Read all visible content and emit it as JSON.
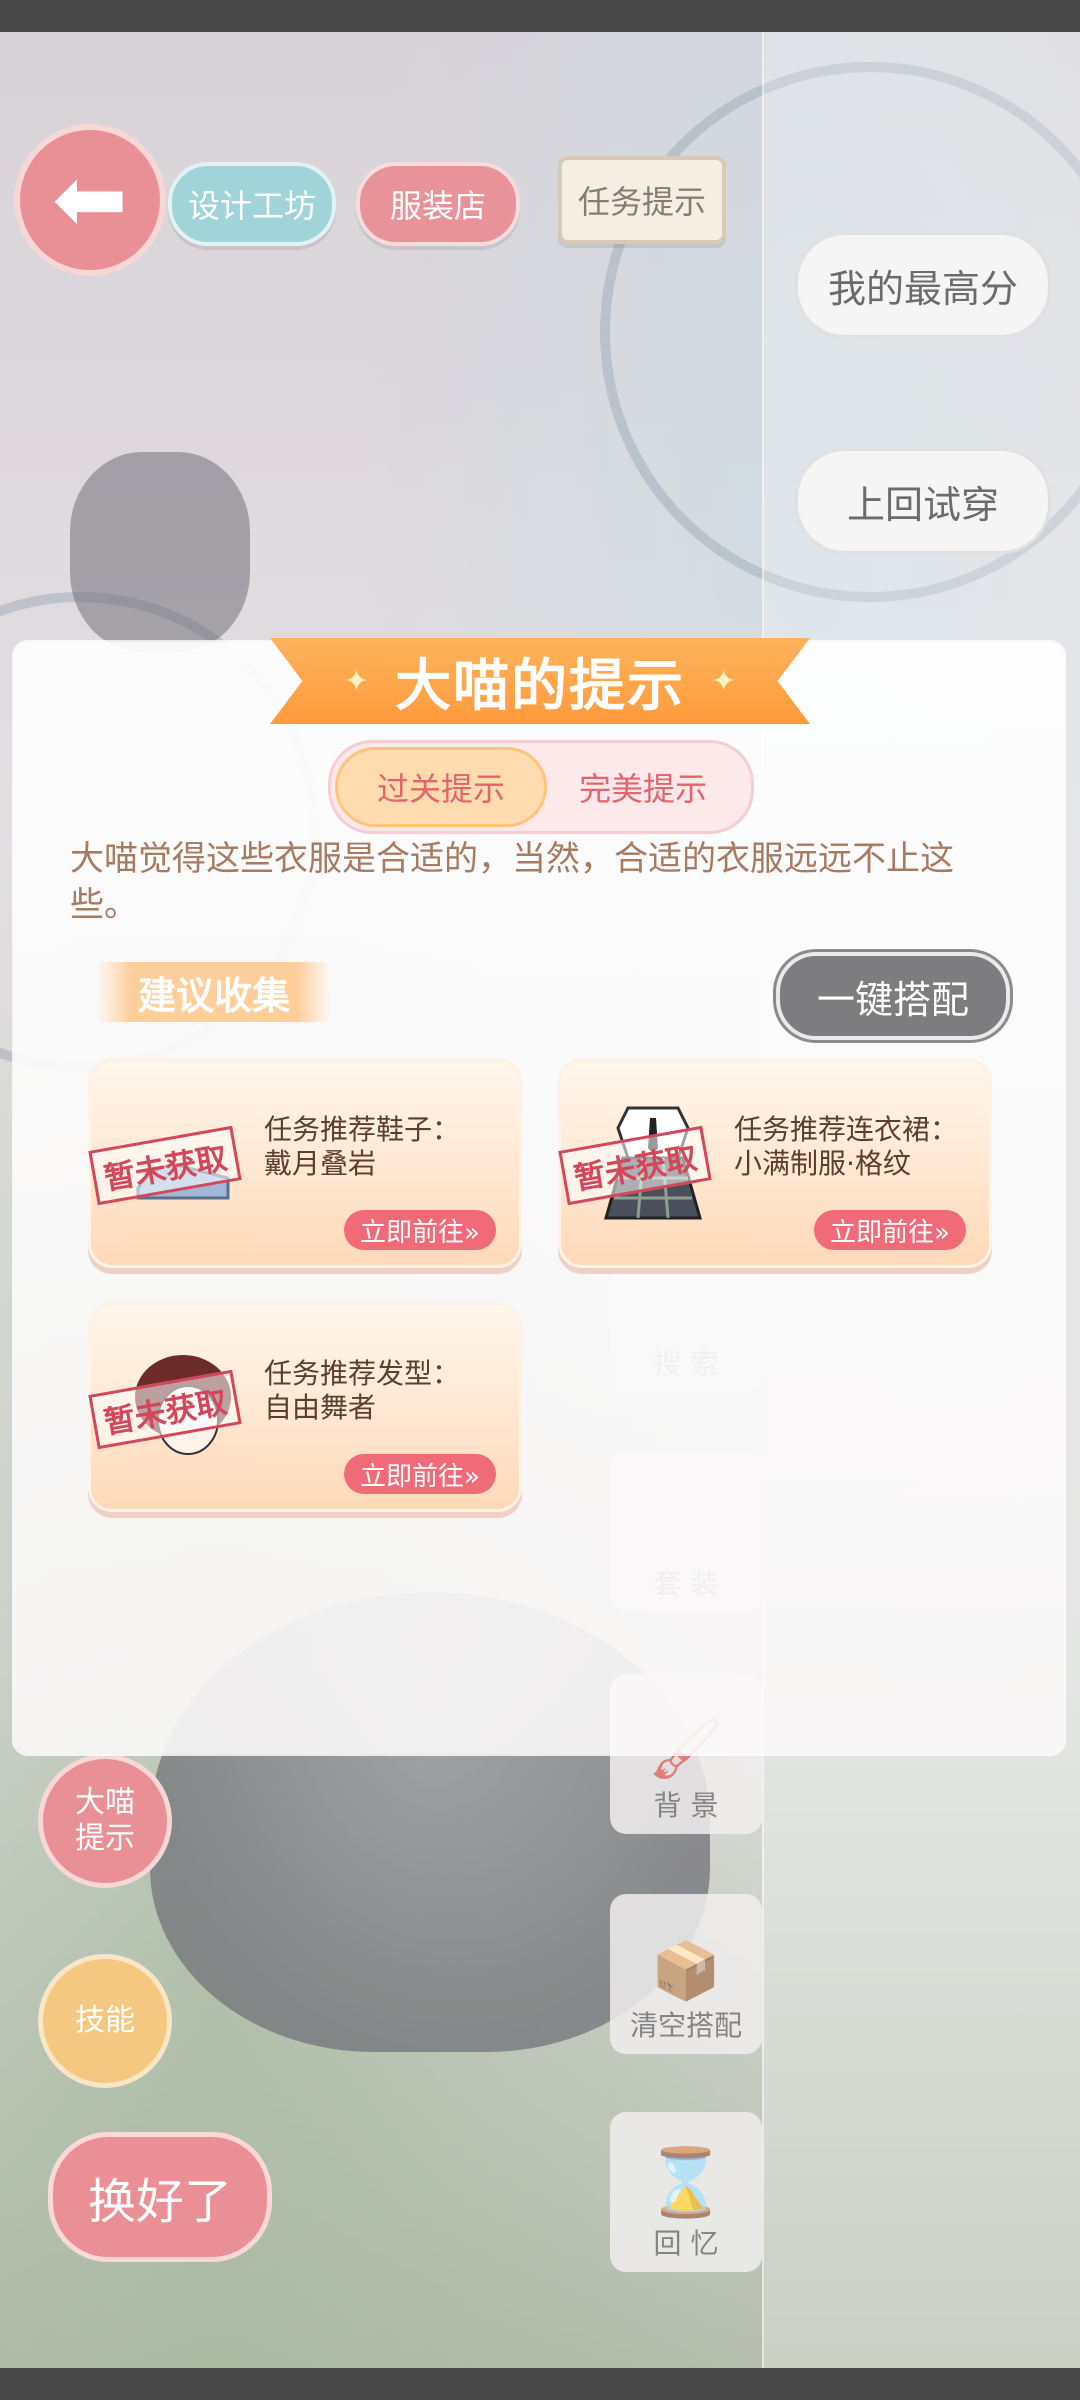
{
  "top_bar": {
    "back_icon": "arrow-left-icon",
    "design_workshop": "设计工坊",
    "clothing_store": "服装店",
    "task_hint": "任务提示"
  },
  "side_buttons": {
    "my_best": "我的最高分",
    "last_try": "上回试穿"
  },
  "tools": {
    "search": "搜 索",
    "outfit": "套 装",
    "background": "背 景",
    "clear_outfit": "清空搭配",
    "memory": "回 忆"
  },
  "left_buttons": {
    "hint": "大喵\n提示",
    "skill": "技能",
    "done": "换好了"
  },
  "modal": {
    "title": "大喵的提示",
    "tabs": [
      "过关提示",
      "完美提示"
    ],
    "active_tab": "过关提示",
    "description": "大喵觉得这些衣服是合适的，当然，合适的衣服远远不止这些。",
    "suggest_label": "建议收集",
    "one_key_label": "一键搭配",
    "cards": [
      {
        "line1": "任务推荐鞋子：",
        "line2": "戴月叠岩",
        "stamp": "暂未获取",
        "go": "立即前往»",
        "thumb": "shoes-icon"
      },
      {
        "line1": "任务推荐连衣裙：",
        "line2": "小满制服·格纹",
        "stamp": "暂未获取",
        "go": "立即前往»",
        "thumb": "dress-icon"
      },
      {
        "line1": "任务推荐发型：",
        "line2": "自由舞者",
        "stamp": "暂未获取",
        "go": "立即前往»",
        "thumb": "hair-icon"
      }
    ]
  },
  "colors": {
    "accent_pink": "#e4646c",
    "ribbon_orange": "#ff9a3c",
    "card_bg": "#ffd9b8"
  }
}
